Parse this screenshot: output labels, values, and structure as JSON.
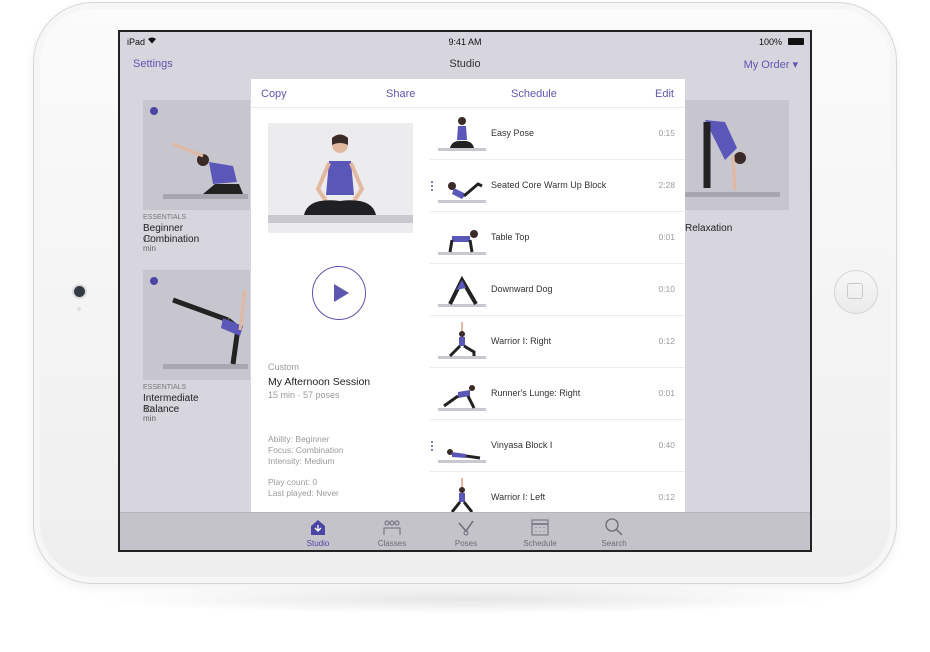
{
  "status_bar": {
    "carrier": "iPad",
    "time": "9:41 AM",
    "battery": "100%"
  },
  "nav_bar": {
    "settings": "Settings",
    "title": "Studio",
    "order": "My Order ▾"
  },
  "background_cards": [
    {
      "category": "ESSENTIALS",
      "title": "Beginner Combination",
      "duration": "15 min"
    },
    {
      "category": "ESSENTIALS",
      "title": "Intermediate Balance",
      "duration": "30 min"
    },
    {
      "category": "",
      "title": "Relaxation",
      "duration": ""
    }
  ],
  "modal": {
    "toolbar": {
      "copy": "Copy",
      "share": "Share",
      "schedule": "Schedule",
      "edit": "Edit"
    },
    "session": {
      "category": "Custom",
      "title": "My Afternoon Session",
      "summary": "15 min · 57 poses",
      "ability": "Ability: Beginner",
      "focus": "Focus: Combination",
      "intensity": "Intensity: Medium",
      "play_count": "Play count: 0",
      "last_played": "Last played: Never"
    },
    "poses": [
      {
        "name": "Easy Pose",
        "time": "0:15",
        "block": false
      },
      {
        "name": "Seated Core Warm Up Block",
        "time": "2:28",
        "block": true
      },
      {
        "name": "Table Top",
        "time": "0:01",
        "block": false
      },
      {
        "name": "Downward Dog",
        "time": "0:10",
        "block": false
      },
      {
        "name": "Warrior I: Right",
        "time": "0:12",
        "block": false
      },
      {
        "name": "Runner's Lunge: Right",
        "time": "0:01",
        "block": false
      },
      {
        "name": "Vinyasa Block I",
        "time": "0:40",
        "block": true
      },
      {
        "name": "Warrior I: Left",
        "time": "0:12",
        "block": false
      }
    ]
  },
  "tabs": [
    {
      "label": "Studio",
      "icon": "house-icon",
      "active": true
    },
    {
      "label": "Classes",
      "icon": "people-icon",
      "active": false
    },
    {
      "label": "Poses",
      "icon": "pose-icon",
      "active": false
    },
    {
      "label": "Schedule",
      "icon": "calendar-icon",
      "active": false
    },
    {
      "label": "Search",
      "icon": "search-icon",
      "active": false
    }
  ],
  "colors": {
    "accent": "#5e57b0",
    "dot": "#4b46a3",
    "tab_inactive": "#6c6b78"
  }
}
